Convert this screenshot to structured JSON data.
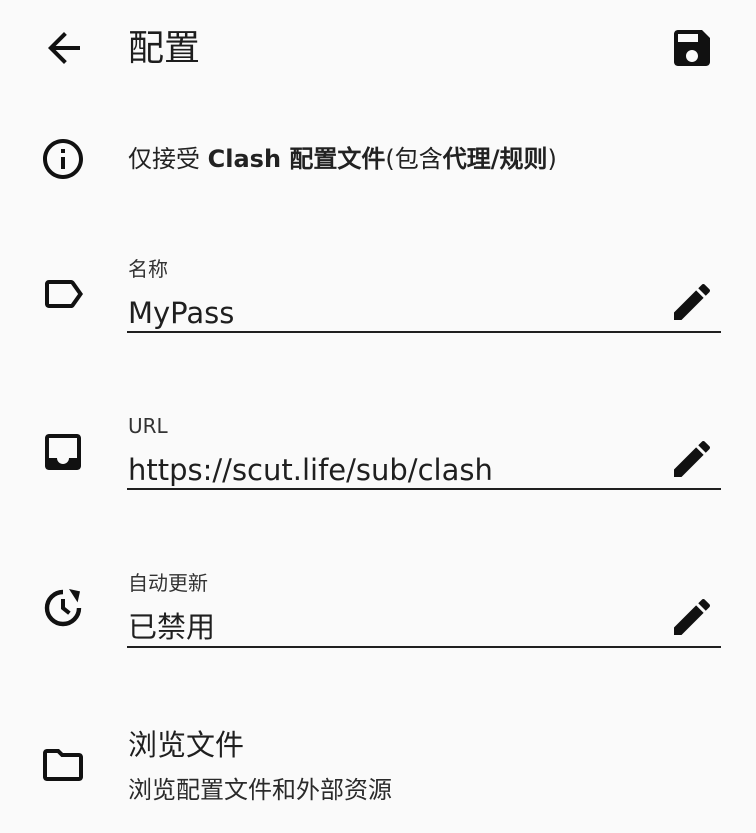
{
  "header": {
    "title": "配置",
    "back_icon": "arrow-back-icon",
    "save_icon": "save-icon"
  },
  "notice": {
    "p1": "仅接受 ",
    "b1": "Clash 配置文件",
    "p2": "(包含",
    "b2": "代理/规则",
    "p3": ")"
  },
  "fields": [
    {
      "label": "名称",
      "value": "MyPass",
      "icon": "label-tag-icon"
    },
    {
      "label": "URL",
      "value": "https://scut.life/sub/clash",
      "icon": "inbox-icon"
    },
    {
      "label": "自动更新",
      "value": "已禁用",
      "icon": "history-clock-icon"
    }
  ],
  "browse": {
    "title": "浏览文件",
    "subtitle": "浏览配置文件和外部资源",
    "icon": "folder-icon"
  },
  "colors": {
    "background": "#fafafa",
    "text": "#1b1b1b",
    "underline": "#1f1f1f"
  }
}
